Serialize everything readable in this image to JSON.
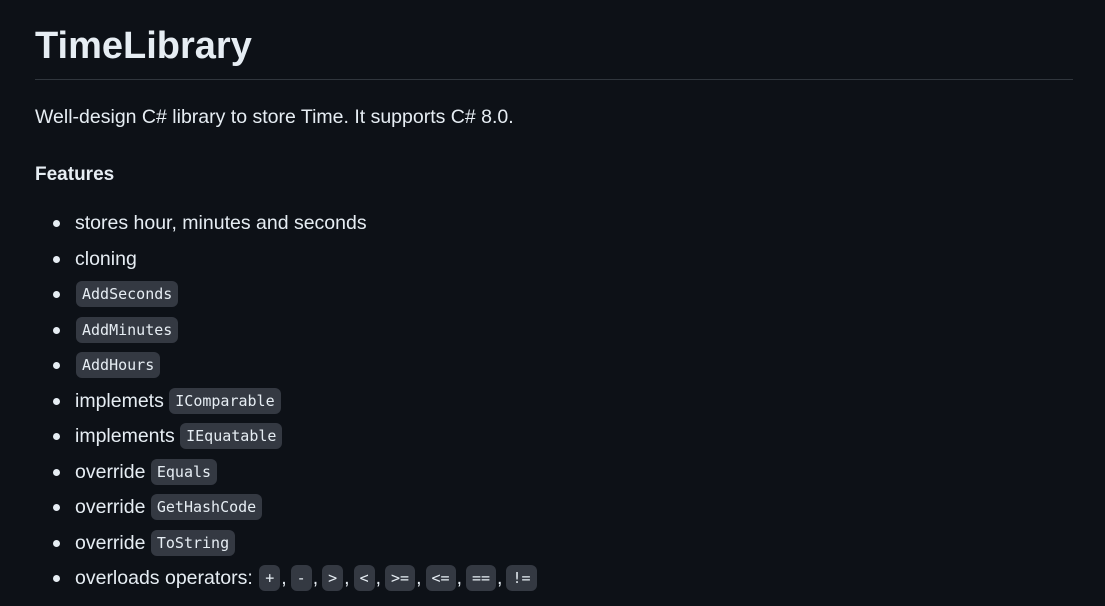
{
  "readme": {
    "title": "TimeLibrary",
    "description": "Well-design C# library to store Time. It supports C# 8.0.",
    "features_heading": "Features",
    "features": [
      {
        "text": "stores hour, minutes and seconds"
      },
      {
        "text": "cloning"
      },
      {
        "code": "AddSeconds"
      },
      {
        "code": "AddMinutes"
      },
      {
        "code": "AddHours"
      },
      {
        "text": "implemets",
        "code": "IComparable"
      },
      {
        "text": "implements",
        "code": "IEquatable"
      },
      {
        "text": "override",
        "code": "Equals"
      },
      {
        "text": "override",
        "code": "GetHashCode"
      },
      {
        "text": "override",
        "code": "ToString"
      }
    ],
    "operators_label": "overloads operators:",
    "operators": [
      "+",
      "-",
      ">",
      "<",
      ">=",
      "<=",
      "==",
      "!="
    ]
  }
}
